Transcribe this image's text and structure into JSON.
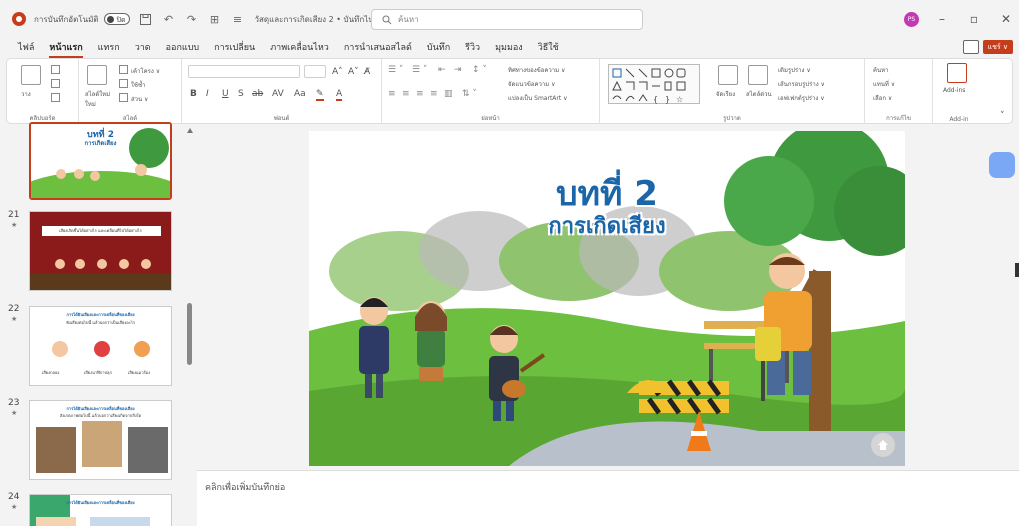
{
  "titlebar": {
    "autosave_label": "การบันทึกอัตโนมัติ",
    "autosave_state": "ปิด",
    "doc_title": "วัสดุและการเกิดเสียง 2 • บันทึกไปยัง พีซีนี้ ∨",
    "search_placeholder": "ค้นหา",
    "avatar_initials": "PS"
  },
  "tabs": [
    "ไฟล์",
    "หน้าแรก",
    "แทรก",
    "วาด",
    "ออกแบบ",
    "การเปลี่ยน",
    "ภาพเคลื่อนไหว",
    "การนำเสนอสไลด์",
    "บันทึก",
    "รีวิว",
    "มุมมอง",
    "วิธีใช้"
  ],
  "active_tab": "หน้าแรก",
  "share_label": "แชร์ ∨",
  "ribbon": {
    "clipboard": {
      "label": "คลิปบอร์ด",
      "paste": "วาง"
    },
    "slides": {
      "label": "สไลด์",
      "new_slide": "สไลด์ใหม่",
      "layout": "เค้าโครง ∨",
      "reset": "ใหม่",
      "section": "ส่วน ∨",
      "reuse": "ใช้ซ้ำ"
    },
    "font": {
      "label": "ฟอนต์",
      "buttons": [
        "B",
        "I",
        "U",
        "S",
        "ab",
        "AV",
        "Aa",
        "A"
      ]
    },
    "paragraph": {
      "label": "ย่อหน้า",
      "text_direction": "ทิศทางของข้อความ ∨",
      "align_text": "จัดแนวข้อความ ∨",
      "smartart": "แปลงเป็น SmartArt ∨"
    },
    "drawing": {
      "label": "รูปวาด",
      "arrange": "จัดเรียง",
      "quick_styles": "สไตล์ด่วน",
      "fill": "เติมรูปร่าง ∨",
      "outline": "เส้นกรอบรูปร่าง ∨",
      "effects": "เอฟเฟกต์รูปร่าง ∨"
    },
    "editing": {
      "label": "การแก้ไข",
      "find": "ค้นหา",
      "replace": "แทนที่ ∨",
      "select": "เลือก ∨"
    },
    "addins": {
      "label": "Add-in",
      "button": "Add-ins"
    }
  },
  "thumbnails": [
    {
      "number": "",
      "title": "บทที่ 2",
      "subtitle": "การเกิดเสียง",
      "selected": true
    },
    {
      "number": "21",
      "title": "เสียงเกิดขึ้นได้อย่างไร และเคลื่อนที่ไปได้อย่างไร",
      "subtitle": "",
      "selected": false
    },
    {
      "number": "22",
      "title": "การได้ยินเสียงและการเคลื่อนที่ของเสียง",
      "subtitle": "ฟังเสียงต่อไปนี้ แล้วบอกว่าเป็นเสียงอะไร",
      "items": [
        "เสียงกลอง",
        "เสียงนาฬิกาปลุก",
        "เสียงแมวร้อง"
      ],
      "selected": false
    },
    {
      "number": "23",
      "title": "การได้ยินเสียงและการเคลื่อนที่ของเสียง",
      "subtitle": "สังเกตภาพต่อไปนี้ แล้วบอกว่าเสียงเกิดจากสิ่งใด",
      "selected": false
    },
    {
      "number": "24",
      "title": "การได้ยินเสียงและการเคลื่อนที่ของเสียง",
      "subtitle": "",
      "selected": false
    }
  ],
  "slide": {
    "title": "บทที่ 2",
    "subtitle": "การเกิดเสียง",
    "colors": {
      "title": "#1a66a8",
      "sky": "#ffffff",
      "grass": "#6cbf3f",
      "tree": "#3f9a3f"
    }
  },
  "notes_placeholder": "คลิกเพื่อเพิ่มบันทึกย่อ"
}
